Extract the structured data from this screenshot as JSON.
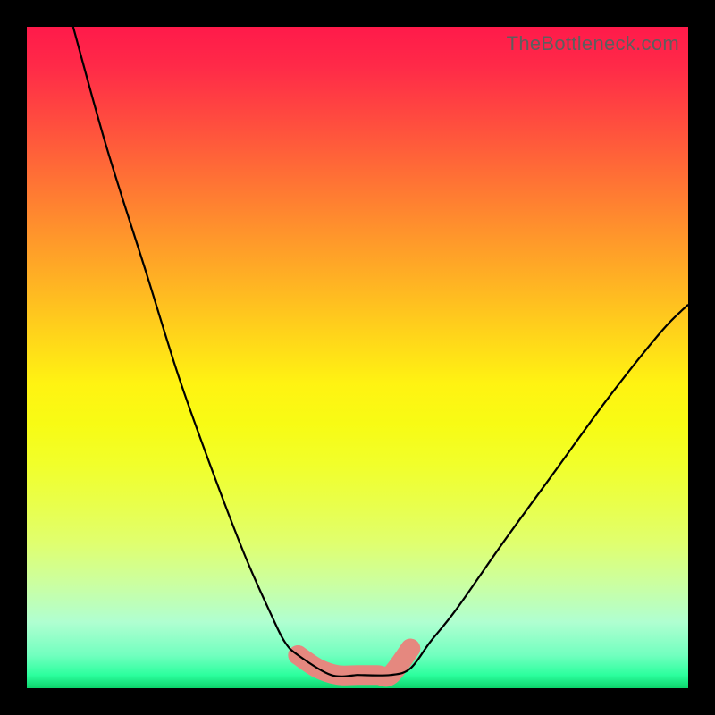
{
  "watermark": "TheBottleneck.com",
  "chart_data": {
    "type": "line",
    "title": "",
    "xlabel": "",
    "ylabel": "",
    "xlim": [
      0,
      100
    ],
    "ylim": [
      0,
      100
    ],
    "grid": false,
    "legend": false,
    "series": [
      {
        "name": "left-curve",
        "x": [
          7,
          12,
          18,
          23,
          28,
          33,
          37,
          39,
          41,
          46,
          50
        ],
        "values": [
          100,
          82,
          63,
          47,
          33,
          20,
          11,
          7,
          5,
          2,
          2
        ]
      },
      {
        "name": "right-curve",
        "x": [
          50,
          55,
          58,
          61,
          65,
          72,
          80,
          88,
          96,
          100
        ],
        "values": [
          2,
          2,
          3,
          7,
          12,
          22,
          33,
          44,
          54,
          58
        ]
      },
      {
        "name": "bottom-band",
        "x": [
          41,
          44,
          47,
          50,
          53,
          55,
          58
        ],
        "values": [
          5,
          3,
          2,
          2,
          2,
          2,
          6
        ]
      }
    ],
    "colors": {
      "curve": "#000000",
      "band": "#e5887f",
      "gradient_top": "#ff1a4a",
      "gradient_mid": "#fff312",
      "gradient_bottom": "#0cd36b"
    }
  }
}
